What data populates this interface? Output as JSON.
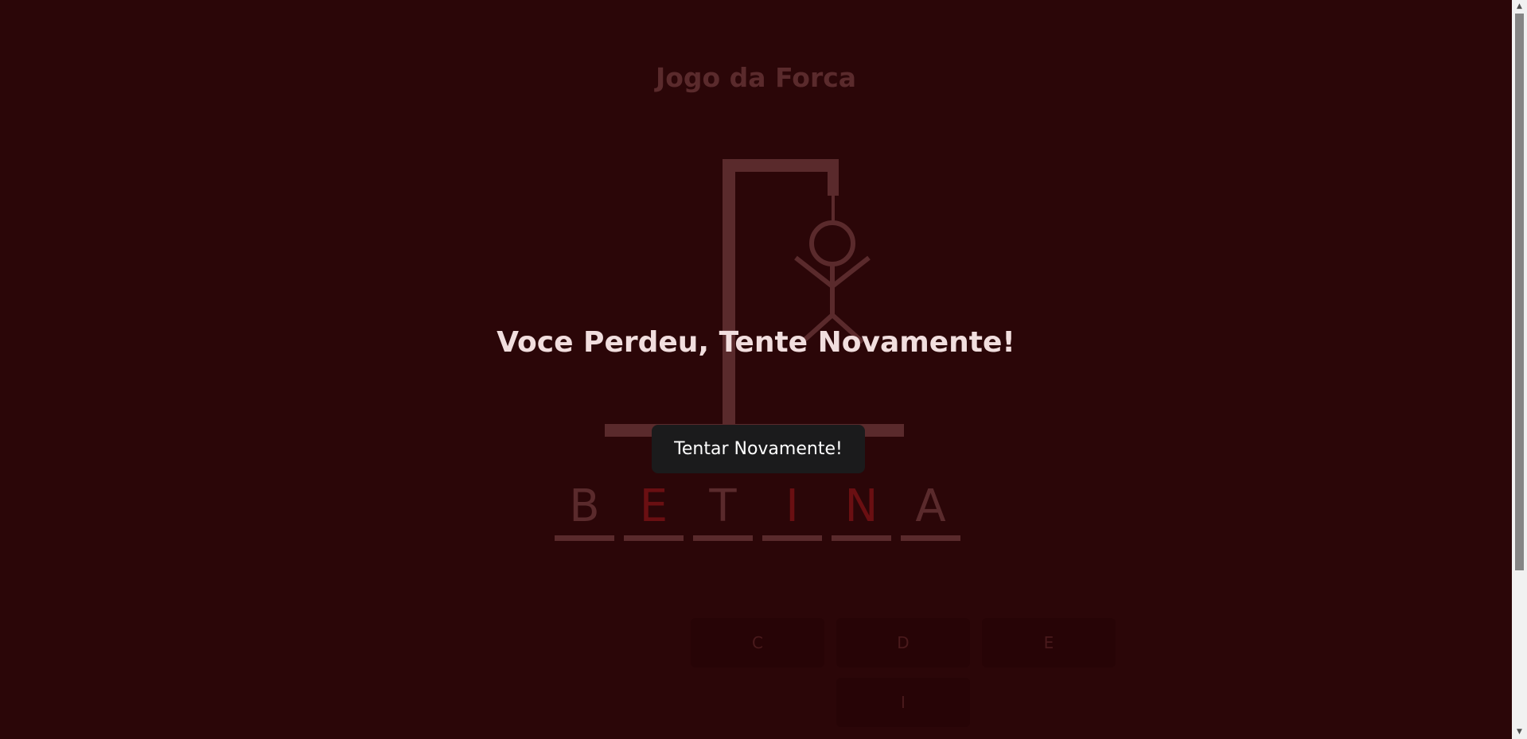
{
  "game": {
    "title": "Jogo da Forca"
  },
  "word": {
    "letters": [
      {
        "char": "B",
        "state": "revealed"
      },
      {
        "char": "E",
        "state": "missed"
      },
      {
        "char": "T",
        "state": "revealed"
      },
      {
        "char": "I",
        "state": "missed"
      },
      {
        "char": "N",
        "state": "missed"
      },
      {
        "char": "A",
        "state": "revealed"
      }
    ]
  },
  "keyboard": {
    "keys": [
      "C",
      "D",
      "E",
      "I"
    ]
  },
  "result": {
    "message": "Voce Perdeu, Tente Novamente!",
    "retry_label": "Tentar Novamente!"
  },
  "colors": {
    "background": "#2b0608",
    "faded": "#5a2a2c",
    "missed_letter": "#6a0f12",
    "button_bg": "#1b1b1c",
    "message": "#f1dede"
  },
  "icons": {
    "scroll_up": "scroll-up-arrow-icon",
    "scroll_down": "scroll-down-arrow-icon"
  }
}
